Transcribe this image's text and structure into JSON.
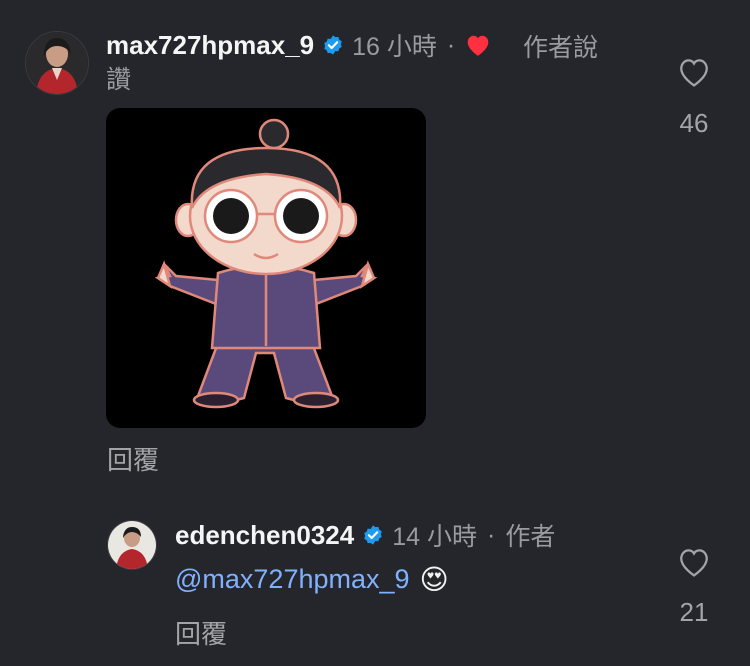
{
  "comments": [
    {
      "username": "max727hpmax_9",
      "time": "16 小時",
      "separator": "·",
      "author_liked_label": "作者說讚",
      "reply_label": "回覆",
      "like_count": "46",
      "media": "sticker-image"
    },
    {
      "username": "edenchen0324",
      "time": "14 小時",
      "separator": "·",
      "author_label": "作者",
      "mention": "@max727hpmax_9",
      "emoji": "😍",
      "reply_label": "回覆",
      "like_count": "21"
    }
  ],
  "colors": {
    "background": "#25262b",
    "verified": "#1d9bf0",
    "author_heart": "#ff3040",
    "mention": "#7fb1ff",
    "muted": "#9a9ba0"
  }
}
